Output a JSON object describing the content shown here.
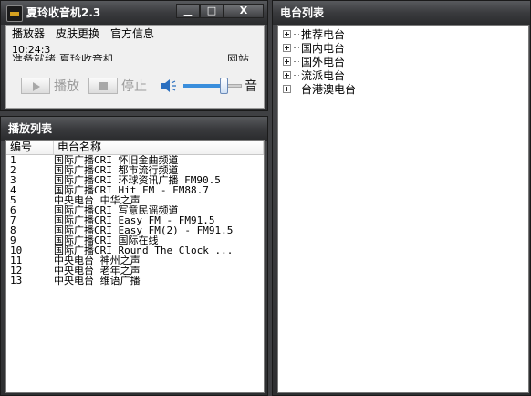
{
  "player": {
    "title": "夏玲收音机2.3",
    "window_buttons": {
      "minimize": "▁",
      "maximize": "□",
      "close": "X"
    },
    "menu": [
      "播放器",
      "皮肤更换",
      "官方信息"
    ],
    "time": "10:24:3",
    "status_left": "准备就绪  夏玲收音机",
    "status_right": "网站",
    "play_label": "播放",
    "stop_label": "停止",
    "volume_label": "音",
    "volume_level": 0.72
  },
  "playlist": {
    "title": "播放列表",
    "columns": [
      "编号",
      "电台名称"
    ],
    "rows": [
      [
        "1",
        "国际广播CRI 怀旧金曲频道"
      ],
      [
        "2",
        "国际广播CRI 都市流行频道"
      ],
      [
        "3",
        "国际广播CRI 环球资讯广播 FM90.5"
      ],
      [
        "4",
        "国际广播CRI Hit FM - FM88.7"
      ],
      [
        "5",
        "中央电台 中华之声"
      ],
      [
        "6",
        "国际广播CRI 写意民谣频道"
      ],
      [
        "7",
        "国际广播CRI Easy FM - FM91.5"
      ],
      [
        "8",
        "国际广播CRI Easy FM(2) - FM91.5"
      ],
      [
        "9",
        "国际广播CRI 国际在线"
      ],
      [
        "10",
        "国际广播CRI Round The Clock ..."
      ],
      [
        "11",
        "中央电台 神州之声"
      ],
      [
        "12",
        "中央电台 老年之声"
      ],
      [
        "13",
        "中央电台 维语广播"
      ]
    ]
  },
  "stations": {
    "title": "电台列表",
    "items": [
      "推荐电台",
      "国内电台",
      "国外电台",
      "流派电台",
      "台港澳电台"
    ]
  }
}
